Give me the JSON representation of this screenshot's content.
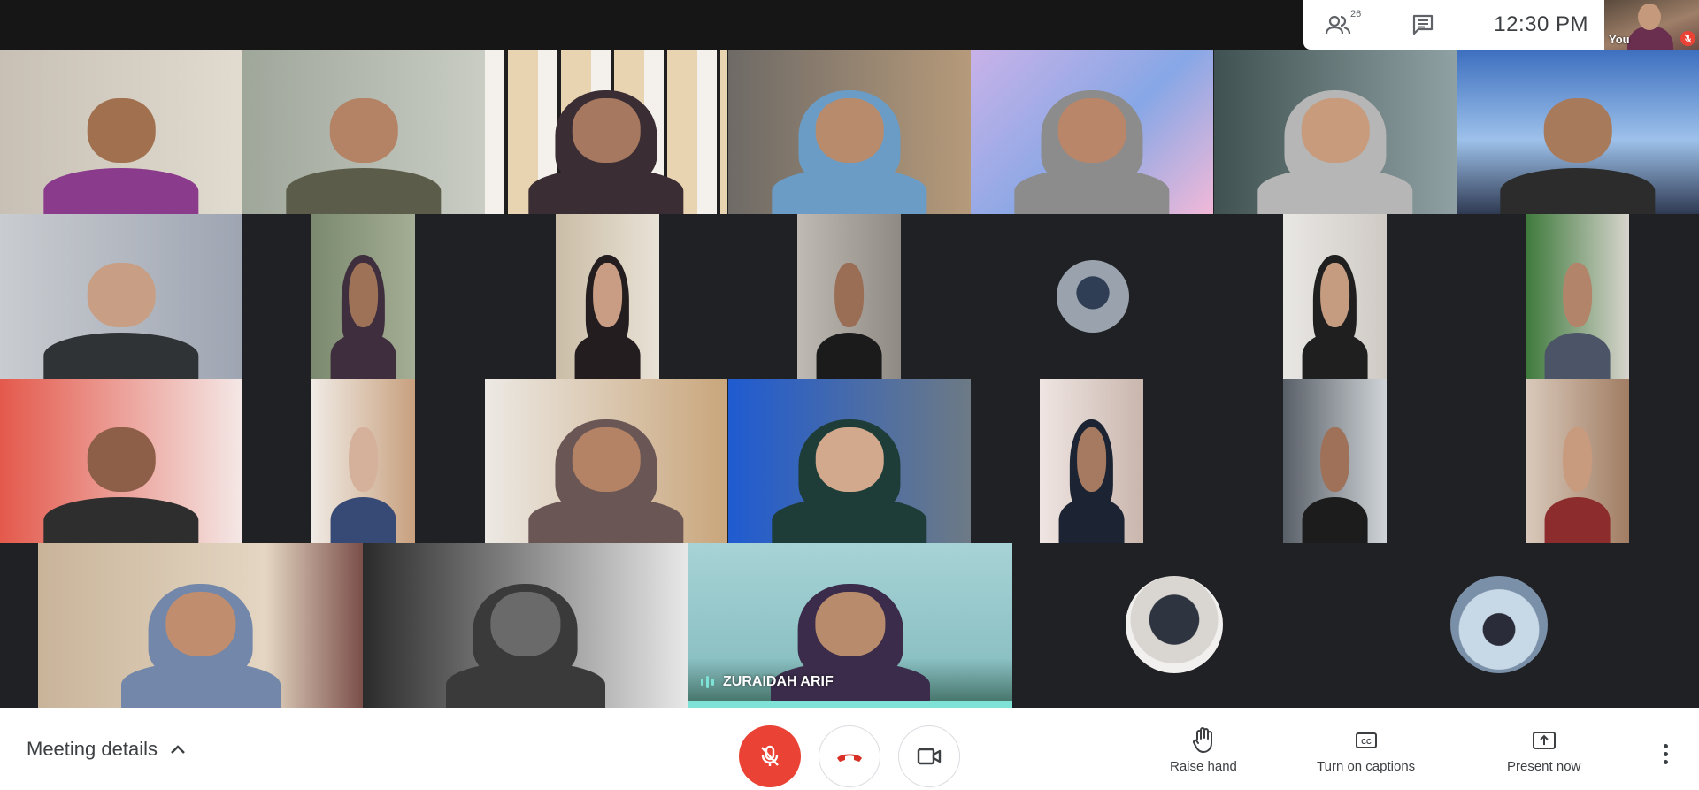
{
  "top_card": {
    "people_icon": "people-icon",
    "participant_count": "26",
    "chat_icon": "chat-icon",
    "time": "12:30 PM"
  },
  "self_view": {
    "label": "You",
    "mic_status_icon": "mic-off-icon"
  },
  "active_speaker": {
    "name": "ZURAIDAH ARIF",
    "indicator_icon": "speaking-indicator-icon"
  },
  "bottom_bar": {
    "meeting_details": "Meeting details",
    "meeting_details_icon": "chevron-up-icon",
    "mic_icon": "mic-off-icon",
    "hangup_icon": "hang-up-icon",
    "camera_icon": "videocam-icon",
    "raise_hand": "Raise hand",
    "raise_hand_icon": "hand-icon",
    "captions": "Turn on captions",
    "captions_icon": "closed-captions-icon",
    "present": "Present now",
    "present_icon": "present-screen-icon",
    "more_icon": "more-vert-icon"
  },
  "colors": {
    "mic_off_red": "#ea4335",
    "speaker_highlight": "#7ee3d6",
    "tile_background": "#202124"
  }
}
